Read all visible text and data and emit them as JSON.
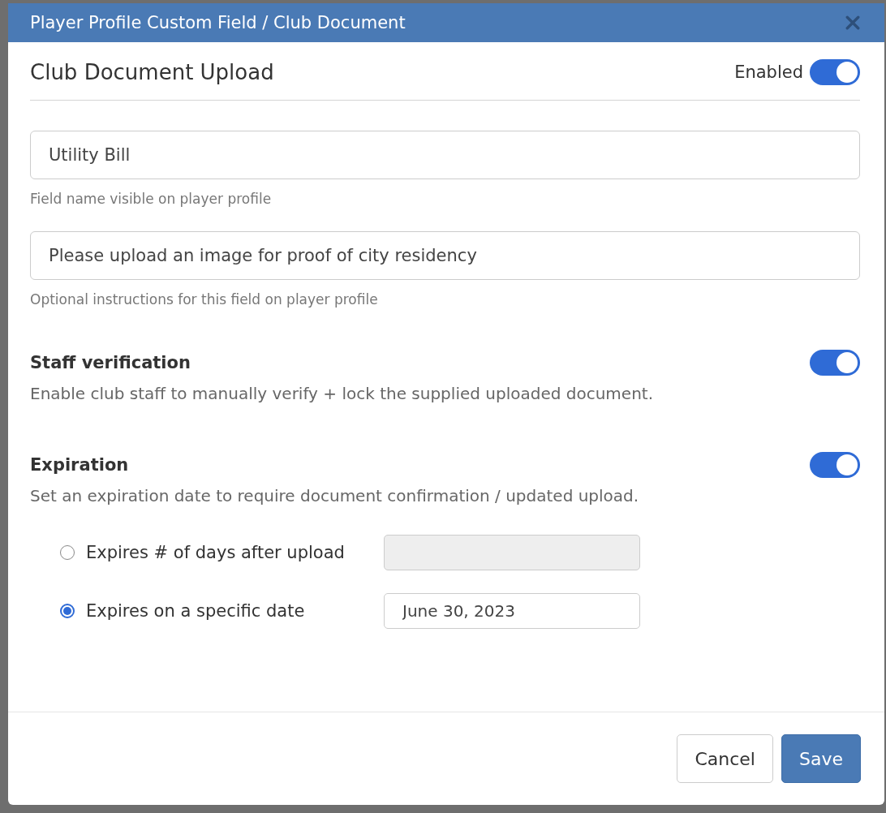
{
  "dialog": {
    "title": "Player Profile Custom Field / Club Document"
  },
  "section": {
    "title": "Club Document Upload",
    "status": {
      "label": "Enabled",
      "on": true
    }
  },
  "fields": [
    {
      "value": "Utility Bill",
      "hint": "Field name visible on player profile"
    },
    {
      "value": "Please upload an image for proof of city residency",
      "hint": "Optional instructions for this field on player profile"
    }
  ],
  "settings": [
    {
      "title": "Staff verification",
      "description": "Enable club staff to manually verify + lock the supplied uploaded document.",
      "on": true
    },
    {
      "title": "Expiration",
      "description": "Set an expiration date to require document confirmation / updated upload.",
      "on": true
    }
  ],
  "expiry_options": [
    {
      "label": "Expires # of days after upload",
      "selected": false,
      "input": {
        "disabled": true
      }
    },
    {
      "label": "Expires on a specific date",
      "selected": true,
      "input": {
        "value": "June 30, 2023",
        "disabled": false
      }
    }
  ],
  "buttons": [
    {
      "label": "Cancel",
      "kind": "secondary"
    },
    {
      "label": "Save",
      "kind": "primary"
    }
  ]
}
